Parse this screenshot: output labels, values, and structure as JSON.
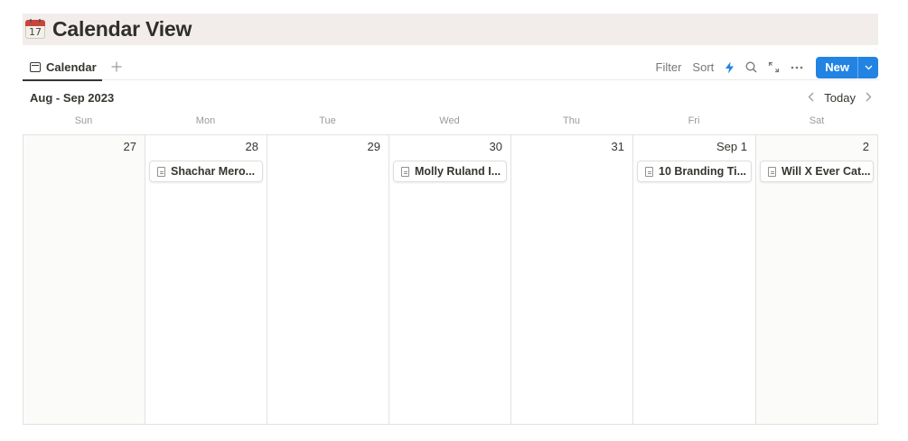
{
  "page": {
    "emoji_day": "17",
    "title": "Calendar View"
  },
  "tabs": {
    "active_label": "Calendar",
    "add_icon": "plus-icon"
  },
  "toolbar": {
    "filter_label": "Filter",
    "sort_label": "Sort",
    "automation_icon": "lightning-icon",
    "search_icon": "search-icon",
    "expand_icon": "expand-icon",
    "more_icon": "more-icon",
    "new_label": "New",
    "new_caret_icon": "chevron-down-icon",
    "accent_color": "#2383e2",
    "lightning_color": "#2383e2"
  },
  "range": {
    "label": "Aug - Sep 2023",
    "prev_icon": "chevron-left-icon",
    "today_label": "Today",
    "next_icon": "chevron-right-icon"
  },
  "weekdays": [
    "Sun",
    "Mon",
    "Tue",
    "Wed",
    "Thu",
    "Fri",
    "Sat"
  ],
  "days": [
    {
      "number": "27",
      "weekend": true,
      "card": null
    },
    {
      "number": "28",
      "weekend": false,
      "card": "Shachar Mero..."
    },
    {
      "number": "29",
      "weekend": false,
      "card": null
    },
    {
      "number": "30",
      "weekend": false,
      "card": "Molly Ruland I..."
    },
    {
      "number": "31",
      "weekend": false,
      "card": null
    },
    {
      "number": "Sep 1",
      "weekend": false,
      "card": "10 Branding Ti..."
    },
    {
      "number": "2",
      "weekend": true,
      "card": "Will X Ever Cat..."
    }
  ]
}
